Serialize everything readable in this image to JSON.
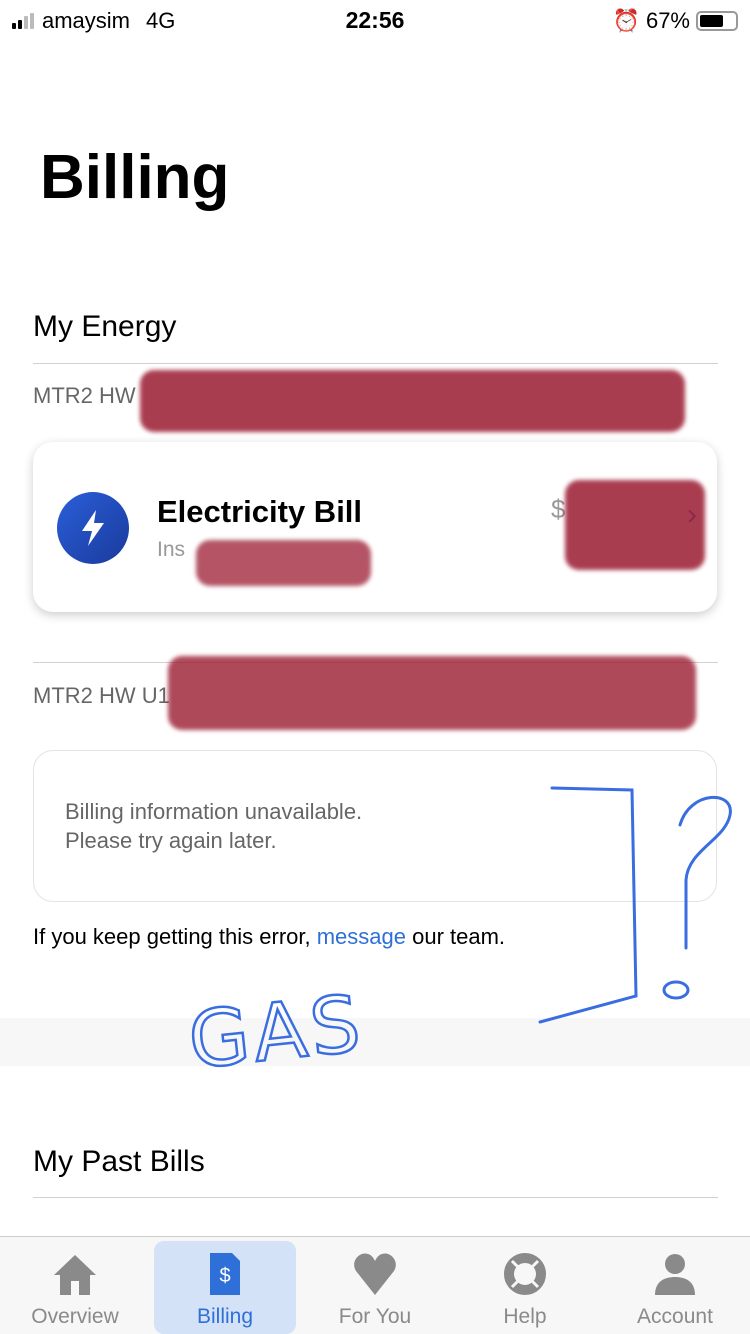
{
  "status_bar": {
    "carrier": "amaysim",
    "network": "4G",
    "time": "22:56",
    "battery": "67%",
    "battery_level": 0.67
  },
  "page_title": "Billing",
  "my_energy": {
    "heading": "My Energy",
    "accounts": [
      {
        "label": "MTR2 HW",
        "card": {
          "title": "Electricity Bill",
          "subtitle": "Ins",
          "amount": "$",
          "icon": "lightning-bolt-icon"
        }
      },
      {
        "label": "MTR2 HW U1",
        "error": {
          "line1": "Billing information unavailable.",
          "line2": "Please try again later."
        }
      }
    ],
    "help_note": {
      "before": "If you keep getting this error, ",
      "link": "message",
      "after": " our team."
    }
  },
  "past_bills": {
    "heading": "My Past Bills"
  },
  "annotation": {
    "text": "GAS",
    "mark": "?"
  },
  "tabs": [
    {
      "label": "Overview",
      "icon": "home-icon"
    },
    {
      "label": "Billing",
      "icon": "bill-icon",
      "active": true
    },
    {
      "label": "For You",
      "icon": "heart-icon"
    },
    {
      "label": "Help",
      "icon": "lifebuoy-icon"
    },
    {
      "label": "Account",
      "icon": "person-icon"
    }
  ],
  "colors": {
    "accent": "#2f6fd8",
    "redaction": "#9b1c32"
  }
}
